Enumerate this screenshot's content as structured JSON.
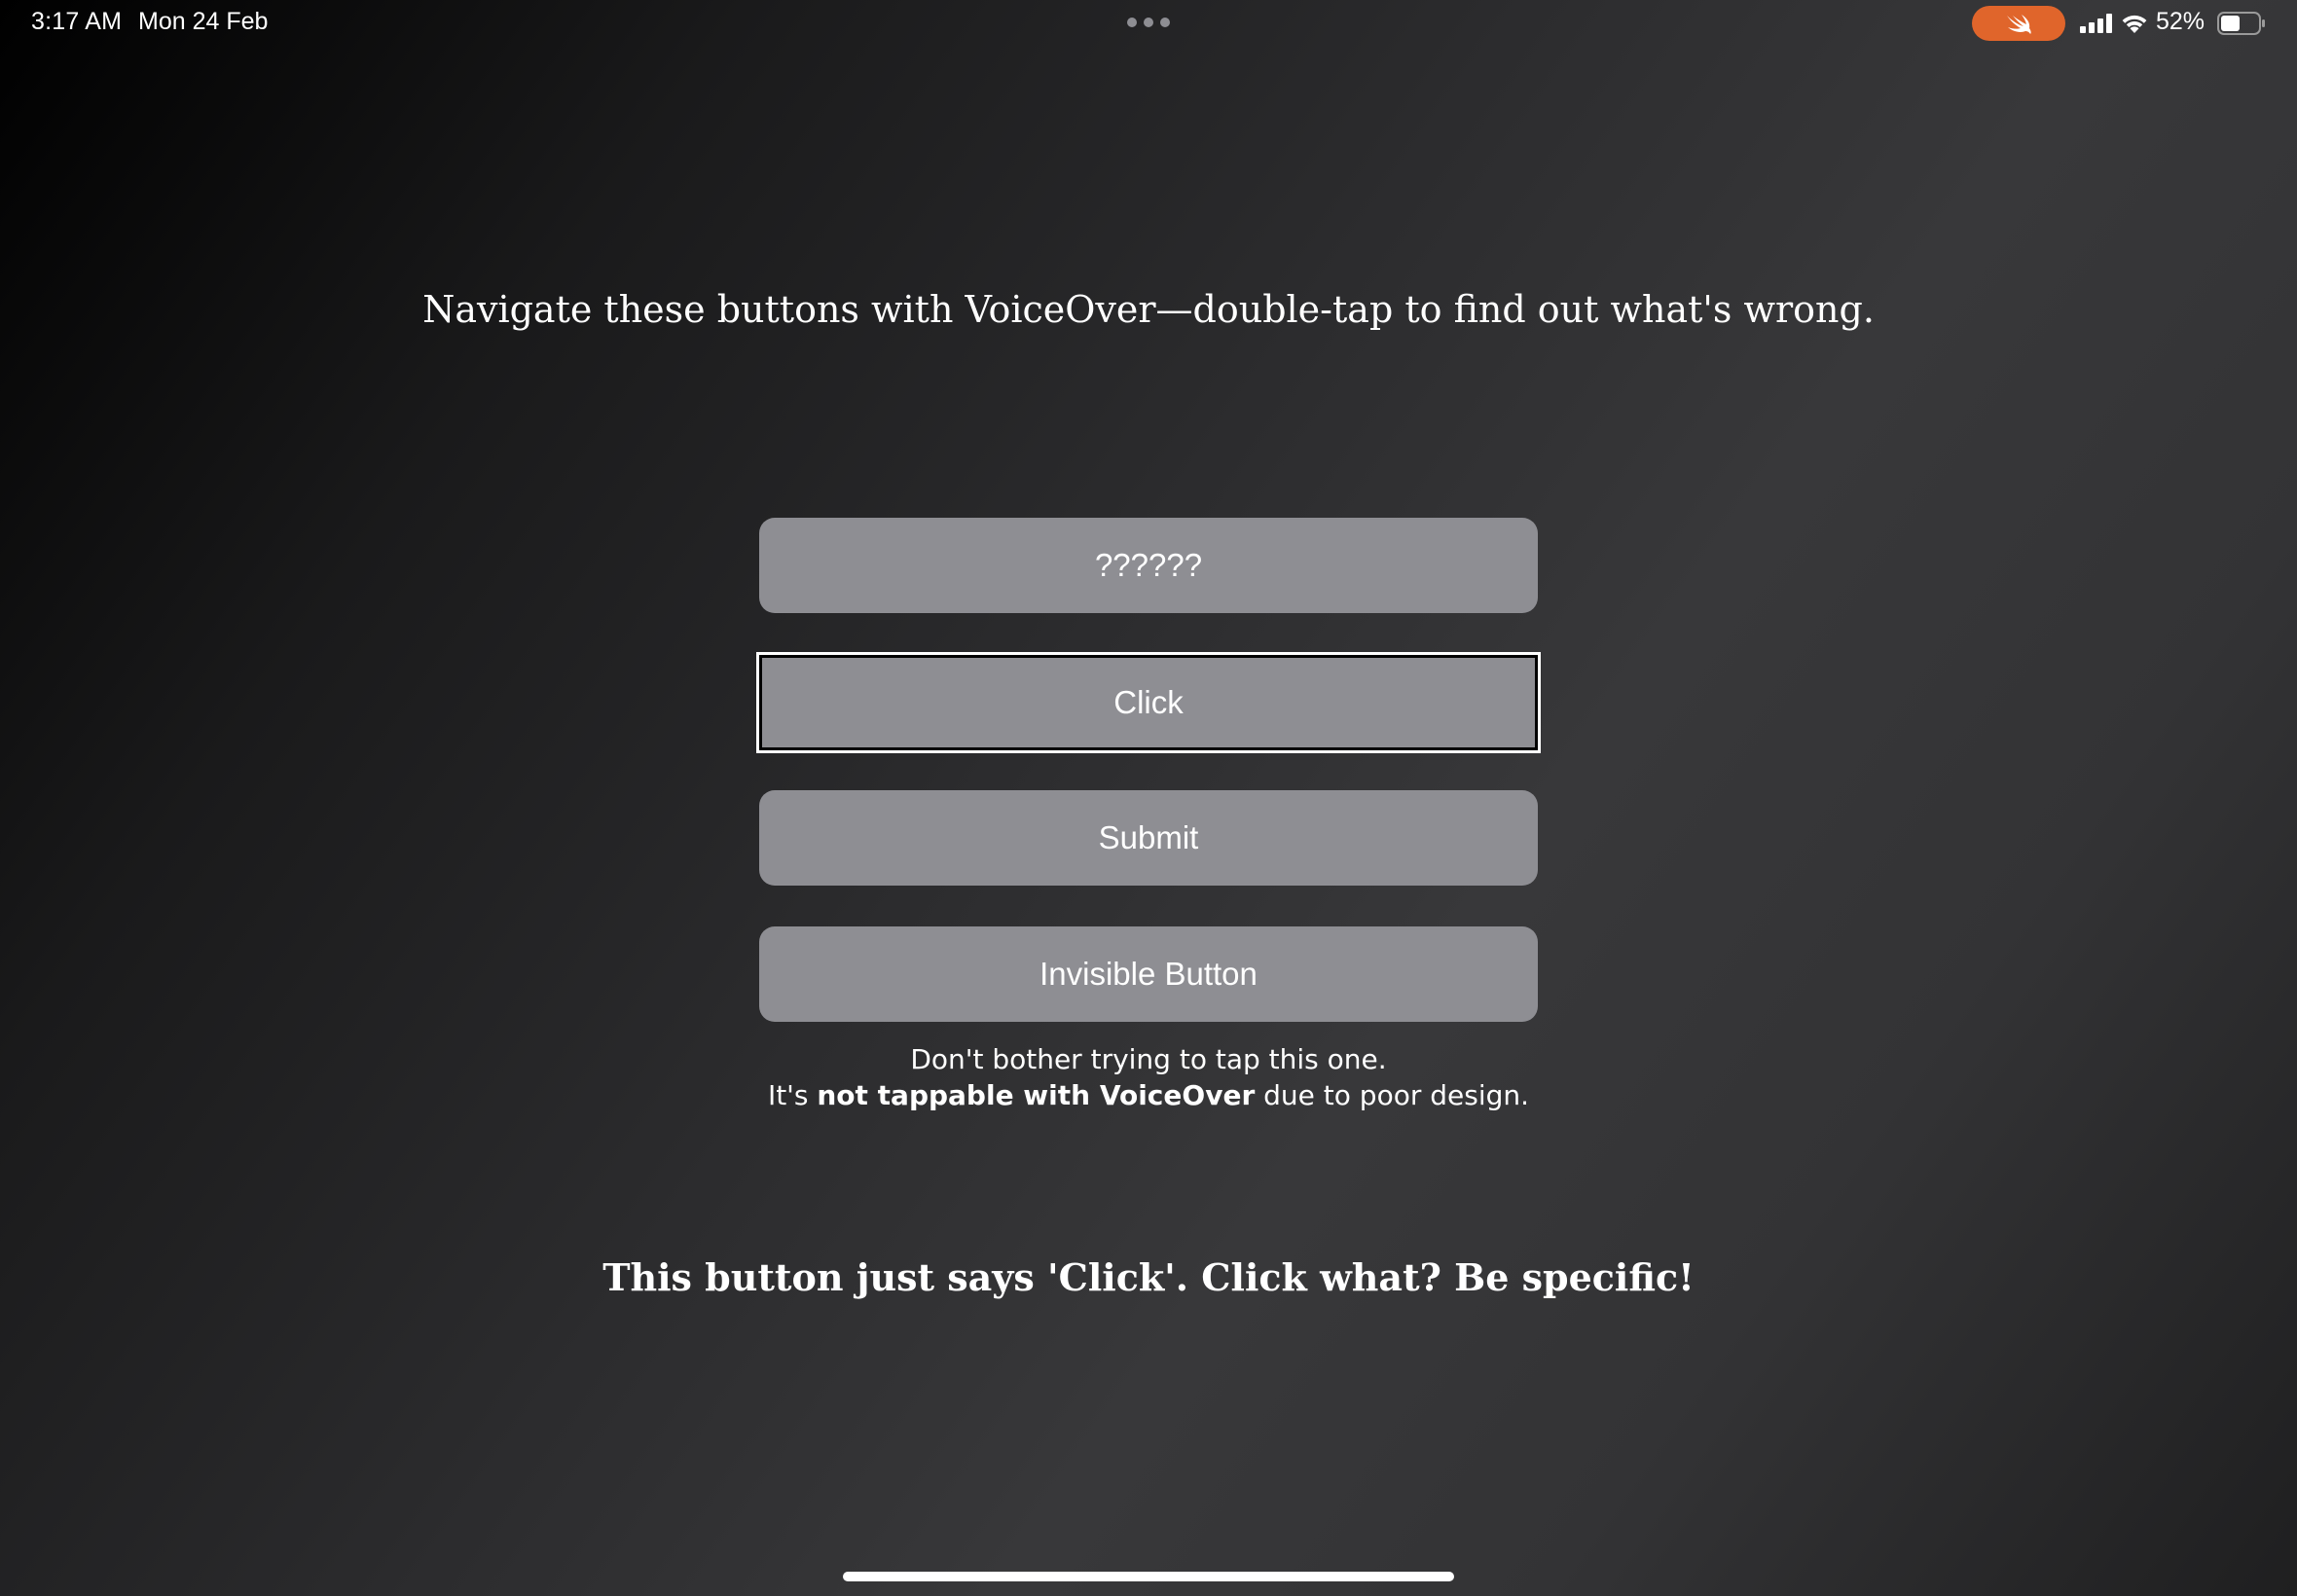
{
  "status_bar": {
    "time": "3:17 AM",
    "date": "Mon 24 Feb",
    "battery_percent": "52%",
    "battery_level": 0.52,
    "icons": [
      "multitasking-dots-icon",
      "swift-playgrounds-icon",
      "cellular-signal-icon",
      "wifi-icon",
      "battery-icon"
    ],
    "accent_color": "#e0652b"
  },
  "main": {
    "headline": "Navigate these buttons with VoiceOver—double-tap to find out what's wrong.",
    "buttons": [
      {
        "label": "??????"
      },
      {
        "label": "Click",
        "focused": true
      },
      {
        "label": "Submit"
      },
      {
        "label": "Invisible Button"
      }
    ],
    "note": {
      "line1": "Don't bother trying to tap this one.",
      "line2_prefix": "It's ",
      "line2_bold": "not tappable with VoiceOver",
      "line2_suffix": " due to poor design."
    },
    "feedback": "This button just says 'Click'. Click what? Be specific!"
  },
  "colors": {
    "button_bg": "#8e8e93",
    "focus_ring": "#ffffff"
  }
}
